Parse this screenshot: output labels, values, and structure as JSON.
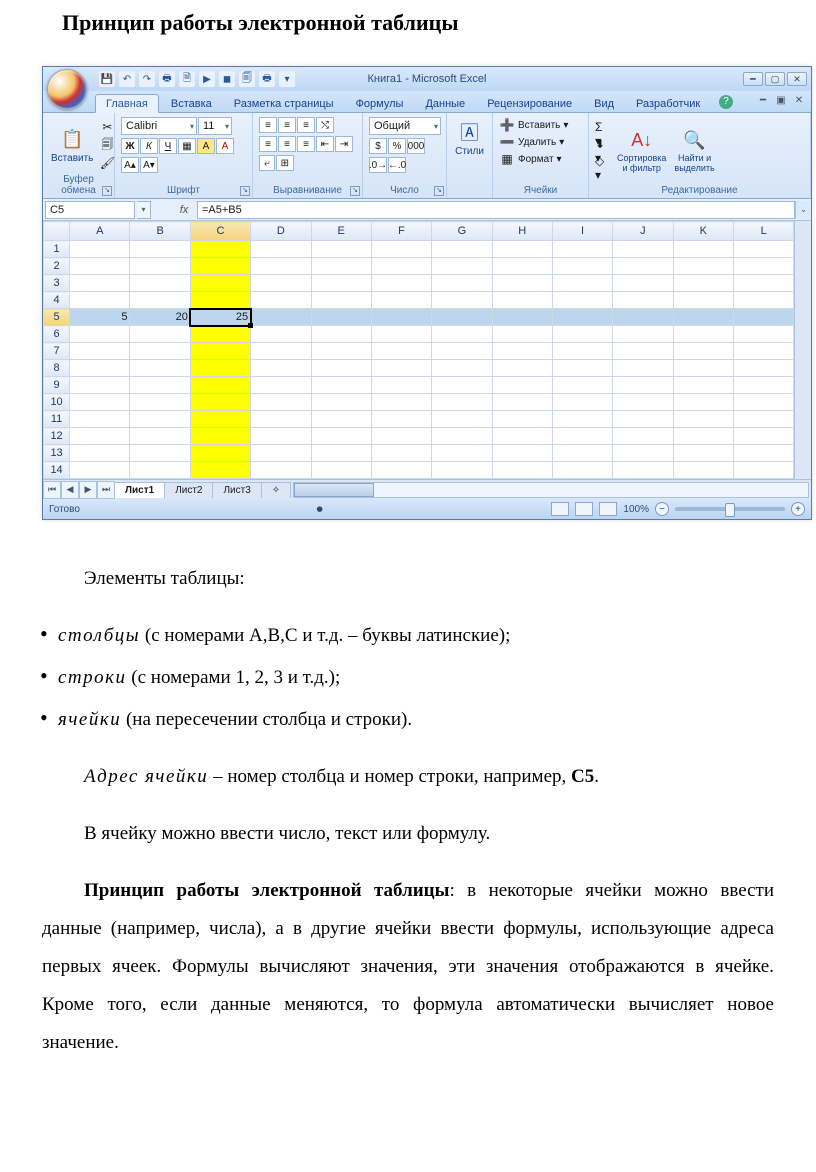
{
  "document": {
    "title": "Принцип работы электронной таблицы",
    "intro": "Элементы таблицы:",
    "bullets": [
      {
        "term": "столбцы",
        "desc": " (с номерами A,B,C и т.д. – буквы латинские);"
      },
      {
        "term": "строки",
        "desc": " (с номерами 1, 2, 3 и т.д.);"
      },
      {
        "term": "ячейки",
        "desc": " (на пересечении столбца и строки)."
      }
    ],
    "addr_term": "Адрес ячейки",
    "addr_desc_1": " – номер столбца и номер строки, например, ",
    "addr_ref": "C5",
    "addr_desc_2": ".",
    "p2": "В ячейку можно ввести число, текст или формулу.",
    "p3_bold": "Принцип работы электронной таблицы",
    "p3_rest": ": в некоторые ячейки можно ввести данные (например, числа), а в другие ячейки ввести формулы, использующие адреса первых ячеек. Формулы вычисляют значения, эти значения отображаются в ячейке. Кроме того, если данные меняются, то формула автоматически вычисляет новое значение."
  },
  "excel": {
    "title": "Книга1 - Microsoft Excel",
    "tabs": [
      "Главная",
      "Вставка",
      "Разметка страницы",
      "Формулы",
      "Данные",
      "Рецензирование",
      "Вид",
      "Разработчик"
    ],
    "ribbon": {
      "clipboard": {
        "label": "Буфер обмена",
        "paste": "Вставить"
      },
      "font": {
        "label": "Шрифт",
        "name": "Calibri",
        "size": "11",
        "bold": "Ж",
        "italic": "К",
        "underline": "Ч"
      },
      "align": {
        "label": "Выравнивание"
      },
      "number": {
        "label": "Число",
        "format": "Общий"
      },
      "styles": {
        "label": "",
        "btn": "Стили"
      },
      "cells": {
        "label": "Ячейки",
        "insert": "Вставить",
        "delete": "Удалить",
        "format": "Формат"
      },
      "editing": {
        "label": "Редактирование",
        "sort": "Сортировка\nи фильтр",
        "find": "Найти и\nвыделить"
      }
    },
    "namebox": "C5",
    "formula": "=A5+B5",
    "columns": [
      "A",
      "B",
      "C",
      "D",
      "E",
      "F",
      "G",
      "H",
      "I",
      "J",
      "K",
      "L"
    ],
    "rows": [
      1,
      2,
      3,
      4,
      5,
      6,
      7,
      8,
      9,
      10,
      11,
      12,
      13,
      14
    ],
    "cells": {
      "A5": "5",
      "B5": "20",
      "C5": "25"
    },
    "sheets": [
      "Лист1",
      "Лист2",
      "Лист3"
    ],
    "status": "Готово",
    "zoom": "100%"
  }
}
